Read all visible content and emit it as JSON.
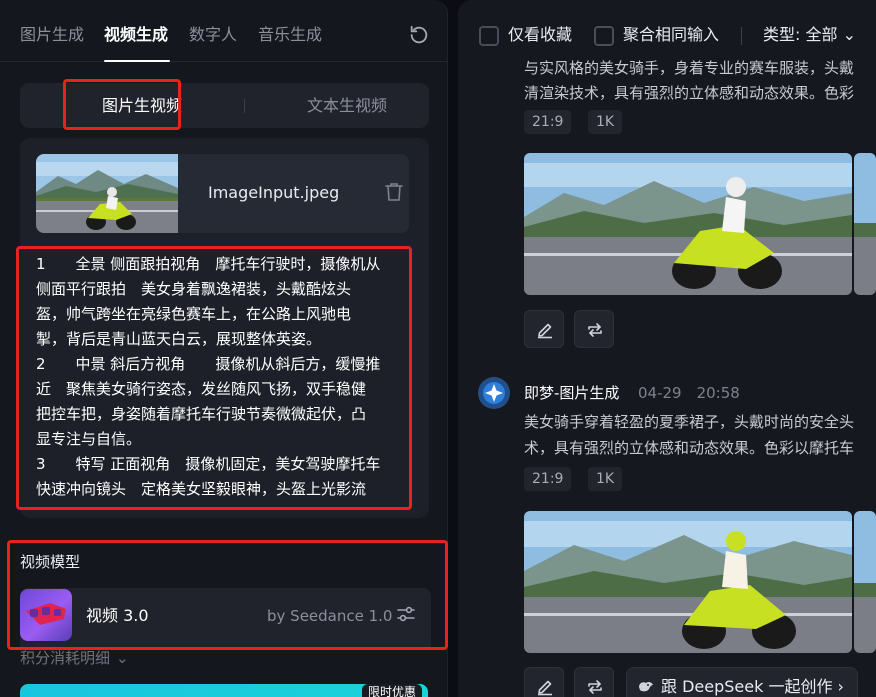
{
  "nav": {
    "tabs": [
      {
        "label": "图片生成",
        "active": false
      },
      {
        "label": "视频生成",
        "active": true
      },
      {
        "label": "数字人",
        "active": false
      },
      {
        "label": "音乐生成",
        "active": false
      }
    ]
  },
  "mode": {
    "options": [
      "图片生视频",
      "文本生视频"
    ],
    "active": "图片生视频"
  },
  "upload": {
    "filename": "ImageInput.jpeg"
  },
  "prompt": {
    "lines": [
      "1　　全景 侧面跟拍视角　摩托车行驶时，摄像机从",
      "侧面平行跟拍　美女身着飘逸裙装，头戴酷炫头",
      "盔，帅气跨坐在亮绿色赛车上，在公路上风驰电",
      "掣，背后是青山蓝天白云，展现整体英姿。",
      "2　　中景 斜后方视角　　摄像机从斜后方，缓慢推",
      "近　聚焦美女骑行姿态，发丝随风飞扬，双手稳健",
      "把控车把，身姿随着摩托车行驶节奏微微起伏，凸",
      "显专注与自信。",
      "3　　特写 正面视角　摄像机固定，美女驾驶摩托车",
      "快速冲向镜头　定格美女坚毅眼神，头盔上光影流"
    ]
  },
  "model": {
    "section_title": "视频模型",
    "name": "视频 3.0",
    "by": "by Seedance 1.0"
  },
  "credits": {
    "label": "积分消耗明细"
  },
  "promo": {
    "badge": "限时优惠"
  },
  "filters": {
    "favorites_label": "仅看收藏",
    "merge_label": "聚合相同输入",
    "type_label": "类型: 全部"
  },
  "feed": [
    {
      "desc_lines": [
        "与实风格的美女骑手，身着专业的赛车服装，头戴",
        "清渲染技术，具有强烈的立体感和动态效果。色彩"
      ],
      "tags": [
        "21:9",
        "1K"
      ]
    },
    {
      "author": "即梦-图片生成",
      "time": "04-29　20:58",
      "desc_lines": [
        "美女骑手穿着轻盈的夏季裙子，头戴时尚的安全头",
        "术，具有强烈的立体感和动态效果。色彩以摩托车"
      ],
      "tags": [
        "21:9",
        "1K"
      ]
    }
  ],
  "deepseek": {
    "label": "跟 DeepSeek 一起创作"
  },
  "colors": {
    "highlight": "#e8221f",
    "bike_green": "#c8e022",
    "sky": "#8fbde2"
  }
}
